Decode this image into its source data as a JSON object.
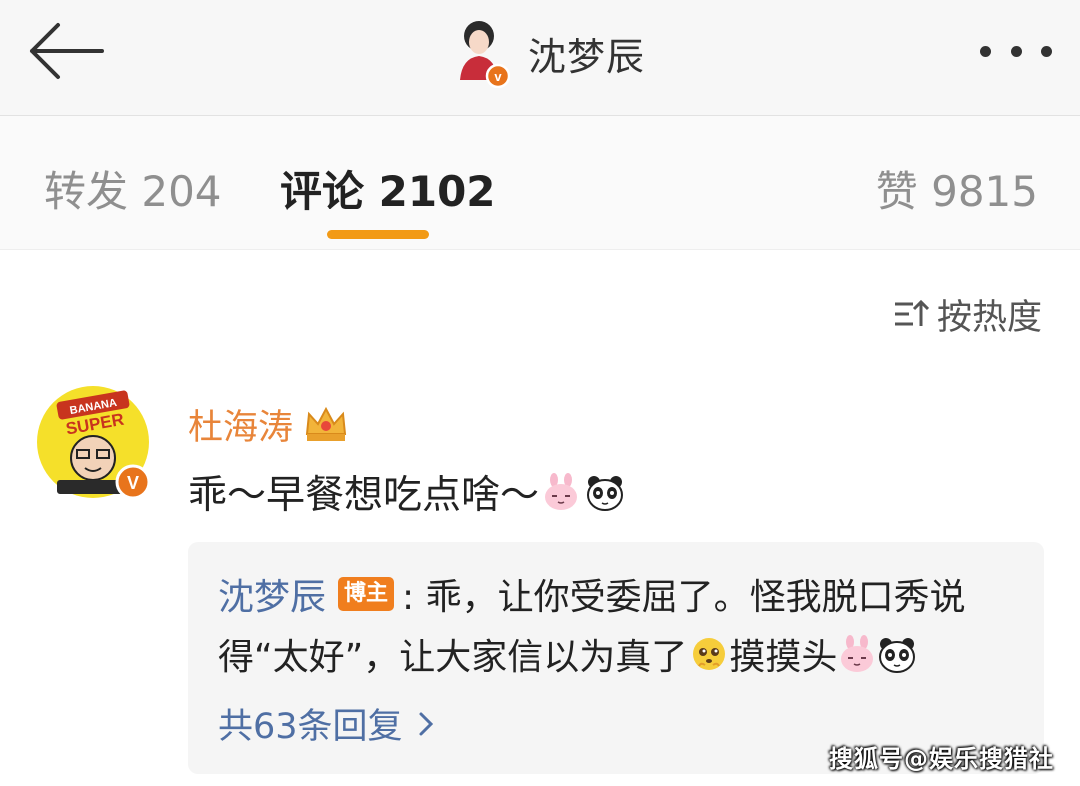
{
  "header": {
    "title": "沈梦辰",
    "back_icon": "arrow-left-icon",
    "more_icon": "more-dots-icon"
  },
  "tabs": [
    {
      "label": "转发 204",
      "active": false
    },
    {
      "label": "评论 2102",
      "active": true
    },
    {
      "label": "赞 9815",
      "active": false
    }
  ],
  "sort": {
    "label": "按热度",
    "icon": "sort-icon"
  },
  "comment": {
    "author": "杜海涛",
    "text": "乖～早餐想吃点啥～",
    "avatar_text": [
      "BANANA",
      "SUPER"
    ],
    "reply": {
      "author": "沈梦辰",
      "badge": "博主",
      "line1": ": 乖，让你受委屈了。怪我脱口秀说",
      "line2_a": "得“太好”，让大家信以为真了",
      "line2_b": " 摸摸头",
      "more": "共63条回复"
    }
  },
  "watermark": "搜狐号@娱乐搜猎社",
  "colors": {
    "accent": "#f29a16",
    "username": "#e8853a",
    "link": "#4f6fa4",
    "badge": "#f07e1e"
  }
}
